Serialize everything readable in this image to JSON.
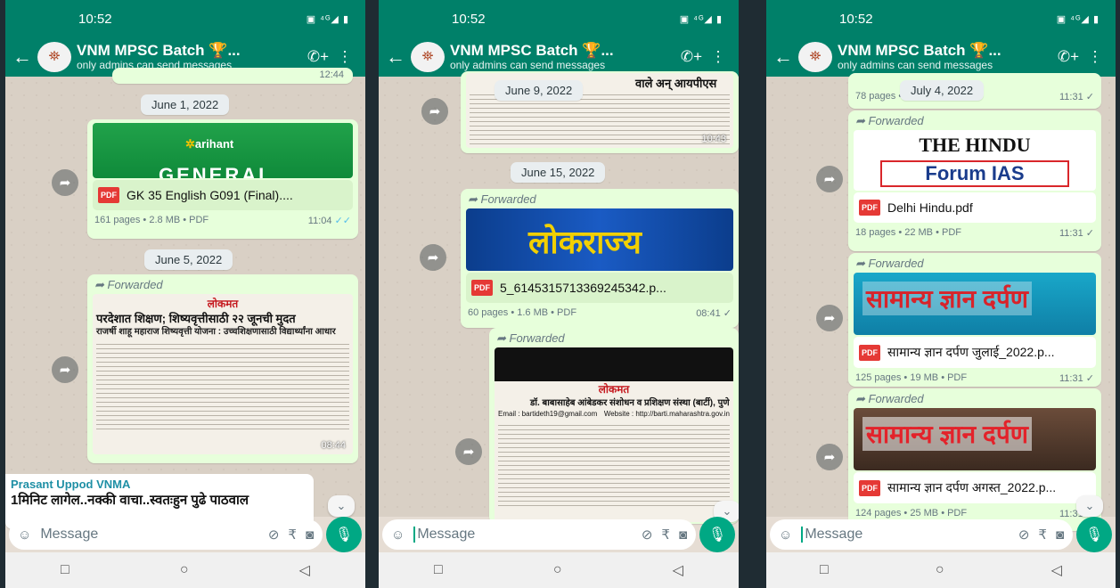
{
  "status": {
    "time": "10:52"
  },
  "header": {
    "title": "VNM MPSC Batch 🏆...",
    "subtitle": "only admins can send messages"
  },
  "input": {
    "placeholder": "Message"
  },
  "p1": {
    "top_time": "12:44",
    "date1": "June 1, 2022",
    "msg1": {
      "thumb_brand": "arihant",
      "thumb_word": "GENERAL",
      "filename": "GK 35 English G091 (Final)....",
      "info": "161 pages • 2.8 MB • PDF",
      "time": "11:04"
    },
    "date2": "June 5, 2022",
    "msg2": {
      "forwarded": "Forwarded",
      "paper_masthead": "लोकमत",
      "headline": "परदेशात शिक्षण; शिष्यवृत्तीसाठी २२ जूनची मुदत",
      "subhead": "राजर्षी शाहू महाराज शिष्यवृत्ती योजना : उच्चशिक्षणासाठी विद्यार्थ्यांना आधार",
      "time": "08:44"
    },
    "msg3": {
      "sender": "Prasant Uppod VNMA",
      "text": "1मिनिट लागेल..नक्की वाचा..स्वतःहुन पुढे पाठवाल"
    }
  },
  "p2": {
    "date0": "June 9, 2022",
    "top_text": "वाले अन् आयपीएस झालो",
    "top_time": "10:43",
    "date1": "June 15, 2022",
    "msg1": {
      "forwarded": "Forwarded",
      "thumb_title": "लोकराज्य",
      "filename": "5_6145315713369245342.p...",
      "info": "60 pages • 1.6 MB • PDF",
      "time": "08:41"
    },
    "msg2": {
      "forwarded": "Forwarded",
      "paper_masthead": "लोकमत",
      "notice_title": "डॉ. बाबासाहेब आंबेडकर संशोधन व प्रशिक्षण संस्था (बार्टी), पुणे",
      "email": "Email : bartideth19@gmail.com",
      "website": "Website : http://barti.maharashtra.gov.in"
    }
  },
  "p3": {
    "date0": "July 4, 2022",
    "top_info": "78 pages • 18 MB • PDF",
    "top_time": "11:31",
    "msg1": {
      "forwarded": "Forwarded",
      "paper_name": "THE HINDU",
      "banner": "Forum IAS",
      "filename": "Delhi Hindu.pdf",
      "info": "18 pages • 22 MB • PDF",
      "time": "11:31"
    },
    "msg2": {
      "forwarded": "Forwarded",
      "thumb_title": "सामान्य ज्ञान दर्पण",
      "filename": "सामान्य ज्ञान दर्पण जुलाई_2022.p...",
      "info": "125 pages • 19 MB • PDF",
      "time": "11:31"
    },
    "msg3": {
      "forwarded": "Forwarded",
      "thumb_title": "सामान्य ज्ञान दर्पण",
      "filename": "सामान्य ज्ञान दर्पण अगस्त_2022.p...",
      "info": "124 pages • 25 MB • PDF",
      "time": "11:31"
    }
  },
  "icons": [
    "back-arrow-icon",
    "avatar",
    "add-call-icon",
    "menu-icon",
    "emoji-icon",
    "attach-icon",
    "rupee-icon",
    "camera-icon",
    "mic-icon",
    "share-icon",
    "pdf-icon",
    "double-tick-icon"
  ]
}
